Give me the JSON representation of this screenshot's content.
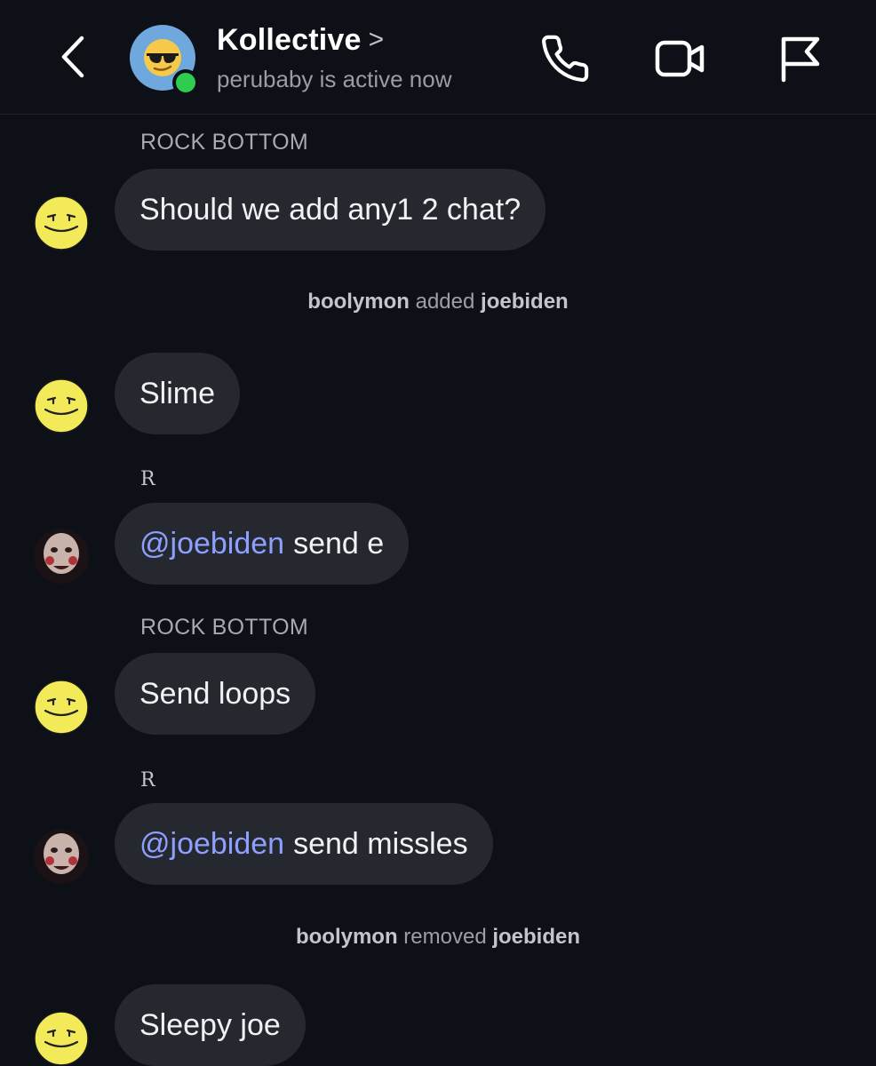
{
  "header": {
    "title": "Kollective",
    "chevron": ">",
    "status": "perubaby is active now",
    "icons": {
      "back": "chevron-left-icon",
      "group_avatar": "sunglasses-emoji-icon",
      "call": "phone-icon",
      "video": "video-camera-icon",
      "report": "flag-icon"
    }
  },
  "colors": {
    "background": "#0e1017",
    "bubble": "#262830",
    "mention": "#8da0ff",
    "online": "#2ecc4f"
  },
  "messages": {
    "sender_1": "ROCK BOTTOM",
    "msg_1": "Should we add any1 2 chat?",
    "sys_1": {
      "actor": "boolymon",
      "action": "added",
      "target": "joebiden"
    },
    "msg_2": "Slime",
    "sender_2": "R",
    "msg_3": {
      "mention": "@joebiden",
      "text": "send e"
    },
    "sender_3": "ROCK BOTTOM",
    "msg_4": "Send loops",
    "sender_4": "R",
    "msg_5": {
      "mention": "@joebiden",
      "text": "send missles"
    },
    "sys_2": {
      "actor": "boolymon",
      "action": "removed",
      "target": "joebiden"
    },
    "msg_6": "Sleepy joe"
  }
}
